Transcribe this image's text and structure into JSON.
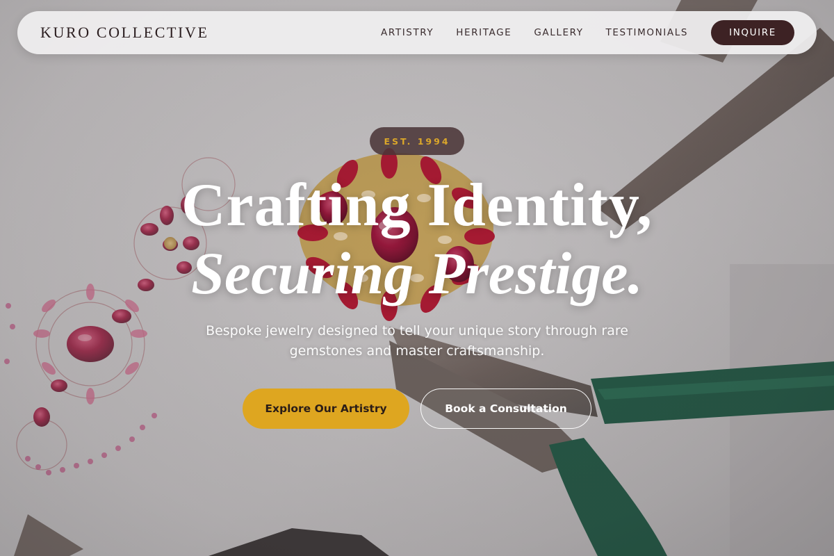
{
  "nav": {
    "brand": "KURO COLLECTIVE",
    "links": [
      "ARTISTRY",
      "HERITAGE",
      "GALLERY",
      "TESTIMONIALS"
    ],
    "inquire_label": "INQUIRE"
  },
  "hero": {
    "badge": "EST. 1994",
    "headline_line1": "Crafting Identity,",
    "headline_line2": "Securing Prestige.",
    "subtext": "Bespoke jewelry designed to tell your unique story through rare gemstones and master craftsmanship.",
    "primary_cta": "Explore Our Artistry",
    "secondary_cta": "Book a Consultation"
  },
  "background": {
    "description_icons": [
      "jewelry-sketch-image",
      "ruby-ring-image",
      "pliers-image"
    ]
  },
  "colors": {
    "brand_dark": "#3d2224",
    "gold_accent": "#dea620",
    "badge_text": "#dba72a",
    "nav_bg": "#f0eff0",
    "pliers_green": "#1f5a45"
  }
}
